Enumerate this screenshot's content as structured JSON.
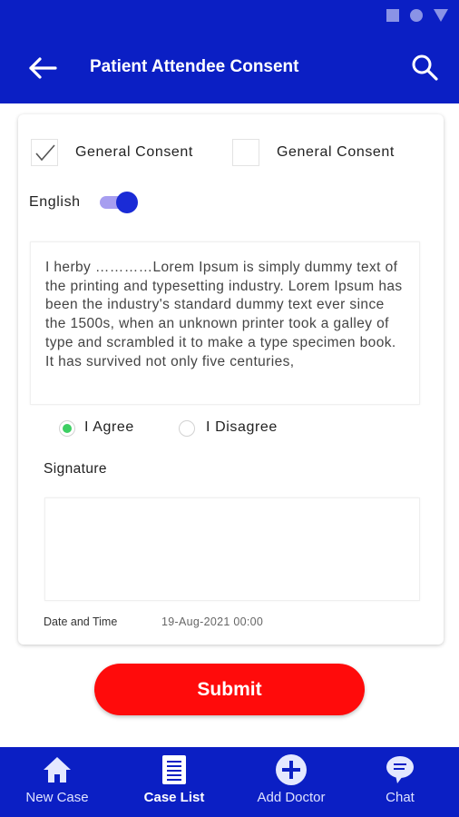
{
  "app_bar": {
    "title": "Patient Attendee Consent",
    "back_icon": "arrow-left-icon",
    "search_icon": "search-icon"
  },
  "consents": [
    {
      "label": "General Consent",
      "checked": true
    },
    {
      "label": "General Consent",
      "checked": false
    }
  ],
  "language": {
    "label": "English",
    "toggle_on": true
  },
  "consent_text": "I herby …………Lorem Ipsum is simply dummy text of the printing and typesetting industry. Lorem Ipsum has been the industry's standard dummy text ever since the 1500s, when an unknown printer took a galley of type and scrambled it to make a type specimen book. It has survived not only five centuries,",
  "agreement": {
    "agree_label": "I Agree",
    "disagree_label": "I Disagree",
    "selected": "agree"
  },
  "signature": {
    "label": "Signature"
  },
  "date_time": {
    "label": "Date and Time",
    "value": "19-Aug-2021 00:00"
  },
  "submit": {
    "label": "Submit"
  },
  "bottom_nav": [
    {
      "label": "New Case",
      "icon": "home-icon",
      "active": false
    },
    {
      "label": "Case List",
      "icon": "list-document-icon",
      "active": true
    },
    {
      "label": "Add Doctor",
      "icon": "add-circle-icon",
      "active": false
    },
    {
      "label": "Chat",
      "icon": "chat-bubble-icon",
      "active": false
    }
  ],
  "colors": {
    "primary": "#0b1fc4",
    "submit": "#ff0b0b",
    "radio_selected": "#3dcf63",
    "toggle_knob": "#1a2bd6",
    "toggle_track": "#a79ef0"
  }
}
